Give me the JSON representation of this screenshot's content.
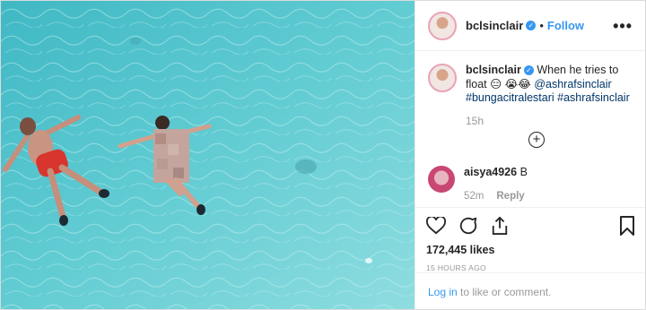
{
  "post": {
    "username": "bclsinclair",
    "follow_label": "Follow",
    "separator": "•",
    "more_label": "•••",
    "caption": {
      "username": "bclsinclair",
      "text_line1": "When he tries to float 😑",
      "emojis": "😭😂",
      "mention": "@ashrafsinclair",
      "tag1": "#bungacitralestari",
      "tag2": "#ashrafsinclair",
      "time": "15h"
    },
    "load_more": "+",
    "comment": {
      "username": "aisya4926",
      "text": "B",
      "time": "52m",
      "reply_label": "Reply"
    },
    "likes": "172,445 likes",
    "posted_ago": "15 HOURS AGO",
    "footer": {
      "login_label": "Log in",
      "rest": " to like or comment."
    }
  }
}
